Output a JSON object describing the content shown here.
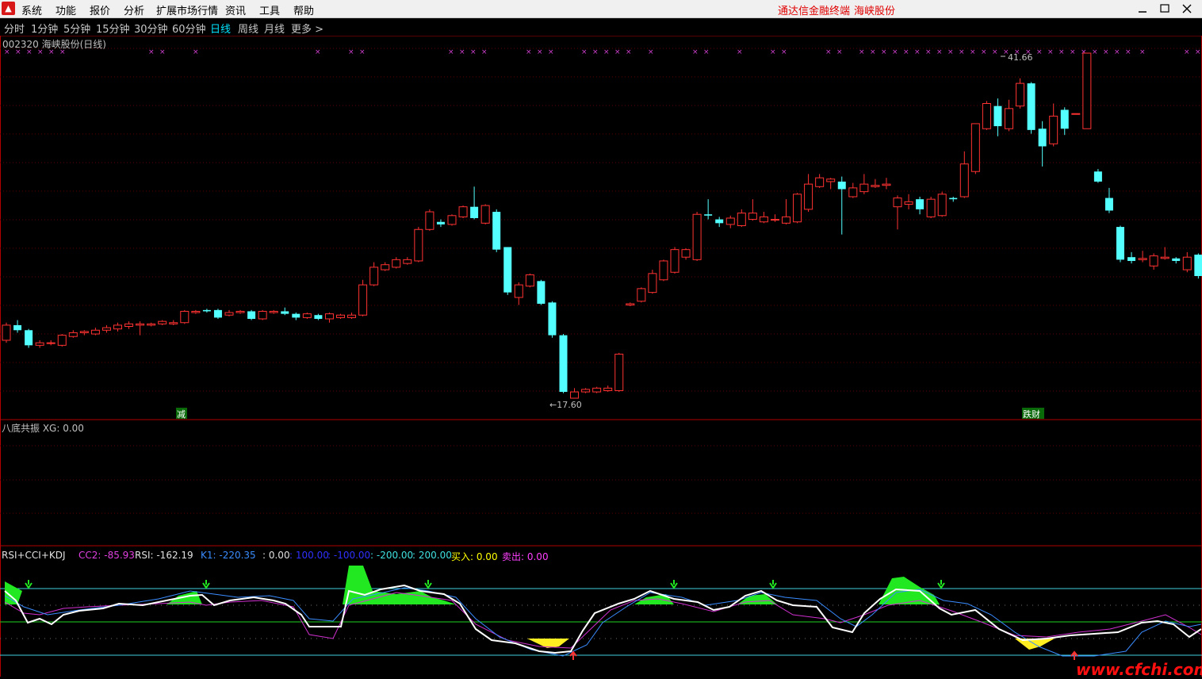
{
  "menu": {
    "items": [
      "系统",
      "功能",
      "报价",
      "分析",
      "扩展市场行情",
      "资讯",
      "工具",
      "帮助"
    ],
    "brand": "通达信金融终端",
    "stock_name": "海峡股份"
  },
  "periods": {
    "items": [
      "分时",
      "1分钟",
      "5分钟",
      "15分钟",
      "30分钟",
      "60分钟",
      "日线",
      "周线",
      "月线",
      "更多 >"
    ],
    "active_index": 6
  },
  "main_chart": {
    "title": "002320 海峡股份(日线)",
    "high_label": "41.66",
    "low_label": "←17.60",
    "signal_left": "减",
    "signal_right": "跌财"
  },
  "middle_panel": {
    "title": "八底共振 XG: 0.00"
  },
  "indicator": {
    "name": "RSI+CCI+KDJ",
    "labels": [
      {
        "text": "CC2: -85.93",
        "color": "#e040e0"
      },
      {
        "text": "RSI: -162.19",
        "color": "#e0e0e0"
      },
      {
        "text": "K1: -220.35",
        "color": "#3a8cff"
      },
      {
        "text": ": 0.00",
        "color": "#e0e0e0"
      },
      {
        "text": ": 100.00",
        "color": "#3030ff"
      },
      {
        "text": ": -100.00",
        "color": "#3030ff"
      },
      {
        "text": ": -200.00",
        "color": "#40e0e0"
      },
      {
        "text": ": 200.00",
        "color": "#40e0e0"
      },
      {
        "text": "买入: 0.00",
        "color": "#ffff00"
      },
      {
        "text": "卖出: 0.00",
        "color": "#ff40ff"
      }
    ]
  },
  "watermark": "www.cfchi.com",
  "chart_data": {
    "type": "candlestick",
    "title": "002320 海峡股份(日线)",
    "high": 41.66,
    "low": 17.6,
    "candles": [
      [
        22.2,
        23.4,
        22.0,
        23.6
      ],
      [
        23.4,
        23.0,
        22.8,
        23.8
      ],
      [
        23.0,
        21.8,
        21.6,
        23.1
      ],
      [
        21.8,
        22.0,
        21.6,
        22.2
      ],
      [
        22.0,
        22.0,
        21.8,
        22.2
      ],
      [
        21.8,
        22.6,
        21.7,
        22.7
      ],
      [
        22.5,
        22.8,
        22.4,
        23.0
      ],
      [
        22.8,
        22.9,
        22.6,
        23.0
      ],
      [
        22.7,
        23.0,
        22.6,
        23.2
      ],
      [
        23.0,
        23.2,
        22.8,
        23.4
      ],
      [
        23.1,
        23.4,
        22.9,
        23.6
      ],
      [
        23.3,
        23.5,
        23.1,
        23.7
      ],
      [
        23.4,
        23.5,
        22.6,
        23.7
      ],
      [
        23.4,
        23.5,
        23.3,
        23.6
      ],
      [
        23.5,
        23.7,
        23.4,
        23.8
      ],
      [
        23.5,
        23.6,
        23.4,
        23.8
      ],
      [
        23.6,
        24.5,
        23.5,
        24.6
      ],
      [
        24.4,
        24.5,
        24.3,
        24.6
      ],
      [
        24.6,
        24.5,
        24.4,
        24.7
      ],
      [
        24.6,
        24.0,
        23.9,
        24.7
      ],
      [
        24.2,
        24.4,
        24.1,
        24.6
      ],
      [
        24.4,
        24.5,
        24.3,
        24.6
      ],
      [
        24.5,
        23.9,
        23.8,
        24.6
      ],
      [
        23.9,
        24.5,
        23.8,
        24.6
      ],
      [
        24.4,
        24.5,
        24.3,
        24.6
      ],
      [
        24.5,
        24.3,
        24.2,
        24.8
      ],
      [
        24.3,
        24.0,
        23.8,
        24.4
      ],
      [
        24.0,
        24.3,
        23.9,
        24.4
      ],
      [
        24.2,
        23.9,
        23.8,
        24.3
      ],
      [
        23.9,
        24.3,
        23.6,
        24.4
      ],
      [
        24.0,
        24.2,
        23.9,
        24.3
      ],
      [
        24.0,
        24.2,
        23.9,
        24.4
      ],
      [
        24.2,
        26.6,
        24.1,
        27.0
      ],
      [
        26.6,
        28.0,
        26.5,
        28.4
      ],
      [
        27.8,
        28.2,
        27.7,
        28.4
      ],
      [
        28.0,
        28.6,
        27.9,
        28.8
      ],
      [
        28.3,
        28.6,
        28.2,
        28.8
      ],
      [
        28.5,
        31.0,
        28.4,
        31.2
      ],
      [
        31.0,
        32.4,
        30.9,
        32.6
      ],
      [
        31.6,
        31.4,
        31.2,
        31.8
      ],
      [
        31.4,
        32.1,
        31.3,
        32.2
      ],
      [
        32.0,
        32.8,
        31.9,
        32.9
      ],
      [
        32.8,
        31.9,
        31.8,
        34.4
      ],
      [
        31.5,
        32.9,
        31.4,
        33.0
      ],
      [
        32.4,
        29.4,
        29.2,
        32.6
      ],
      [
        29.6,
        26.0,
        25.8,
        29.6
      ],
      [
        25.6,
        26.6,
        25.0,
        26.8
      ],
      [
        26.5,
        27.4,
        26.4,
        27.5
      ],
      [
        26.9,
        25.1,
        25.0,
        27.0
      ],
      [
        25.2,
        22.6,
        22.4,
        25.3
      ],
      [
        22.6,
        18.1,
        18.0,
        22.7
      ],
      [
        17.6,
        18.1,
        17.6,
        18.4
      ],
      [
        18.1,
        18.3,
        18.0,
        18.4
      ],
      [
        18.1,
        18.4,
        18.0,
        18.5
      ],
      [
        18.2,
        18.4,
        18.1,
        18.6
      ],
      [
        18.2,
        21.1,
        18.1,
        21.2
      ],
      [
        25.0,
        25.1,
        24.9,
        25.2
      ],
      [
        25.3,
        26.3,
        25.2,
        26.4
      ],
      [
        26.0,
        27.5,
        25.9,
        27.8
      ],
      [
        27.0,
        28.5,
        26.9,
        28.6
      ],
      [
        27.6,
        29.4,
        27.5,
        29.6
      ],
      [
        28.8,
        29.4,
        28.6,
        29.5
      ],
      [
        28.6,
        32.2,
        28.5,
        32.4
      ],
      [
        32.2,
        32.1,
        31.8,
        33.4
      ],
      [
        31.8,
        31.5,
        31.2,
        32.0
      ],
      [
        31.4,
        31.9,
        31.1,
        32.1
      ],
      [
        31.3,
        32.3,
        31.2,
        32.6
      ],
      [
        31.8,
        32.3,
        31.7,
        33.4
      ],
      [
        31.6,
        32.0,
        31.5,
        32.4
      ],
      [
        31.8,
        31.8,
        31.6,
        32.2
      ],
      [
        31.5,
        32.0,
        31.4,
        33.4
      ],
      [
        31.6,
        33.8,
        31.5,
        33.9
      ],
      [
        32.6,
        34.6,
        32.4,
        35.4
      ],
      [
        34.4,
        35.1,
        34.3,
        35.4
      ],
      [
        34.8,
        35.0,
        34.2,
        35.1
      ],
      [
        34.8,
        34.2,
        30.6,
        35.2
      ],
      [
        33.6,
        34.3,
        33.5,
        34.7
      ],
      [
        34.0,
        34.6,
        33.8,
        35.4
      ],
      [
        34.4,
        34.5,
        34.3,
        35.0
      ],
      [
        34.5,
        34.6,
        34.2,
        35.1
      ],
      [
        32.8,
        33.5,
        31.0,
        33.7
      ],
      [
        33.0,
        33.2,
        32.6,
        33.8
      ],
      [
        33.4,
        32.6,
        32.2,
        33.6
      ],
      [
        32.0,
        33.4,
        31.9,
        33.6
      ],
      [
        32.1,
        33.8,
        32.0,
        34.0
      ],
      [
        33.5,
        33.4,
        33.2,
        33.6
      ],
      [
        33.6,
        36.2,
        33.5,
        37.2
      ],
      [
        35.6,
        39.4,
        35.4,
        39.4
      ],
      [
        39.0,
        41.0,
        38.9,
        41.2
      ],
      [
        40.8,
        39.2,
        38.4,
        41.4
      ],
      [
        39.0,
        40.6,
        38.8,
        41.3
      ],
      [
        40.8,
        42.6,
        40.6,
        43.0
      ],
      [
        42.6,
        38.9,
        38.6,
        42.7
      ],
      [
        39.0,
        37.6,
        36.0,
        39.6
      ],
      [
        37.8,
        40.0,
        37.6,
        41.0
      ],
      [
        40.5,
        39.0,
        38.5,
        40.7
      ],
      [
        40.2,
        40.2,
        40.2,
        40.2
      ],
      [
        39.0,
        45.0,
        39.0,
        45.0
      ],
      [
        35.6,
        34.8,
        34.7,
        35.8
      ],
      [
        33.5,
        32.5,
        32.3,
        34.3
      ],
      [
        31.2,
        28.6,
        28.4,
        31.3
      ],
      [
        28.8,
        28.5,
        28.3,
        29.2
      ],
      [
        28.6,
        28.7,
        28.4,
        29.3
      ],
      [
        28.1,
        28.9,
        27.8,
        29.1
      ],
      [
        28.7,
        28.8,
        28.6,
        29.6
      ],
      [
        28.7,
        28.5,
        28.3,
        28.8
      ],
      [
        27.8,
        28.8,
        27.6,
        29.2
      ],
      [
        29.0,
        27.3,
        27.1,
        29.1
      ],
      [
        26.8,
        26.9,
        26.6,
        27.3
      ],
      [
        27.2,
        26.8,
        26.6,
        27.4
      ],
      [
        26.8,
        27.4,
        26.7,
        27.6
      ],
      [
        27.4,
        29.1,
        27.3,
        29.4
      ],
      [
        28.8,
        28.9,
        28.6,
        29.2
      ],
      [
        28.6,
        29.2,
        28.4,
        29.6
      ],
      [
        28.5,
        27.9,
        27.6,
        28.7
      ],
      [
        27.2,
        26.8,
        26.6,
        27.3
      ],
      [
        26.7,
        27.4,
        26.6,
        27.5
      ]
    ]
  }
}
